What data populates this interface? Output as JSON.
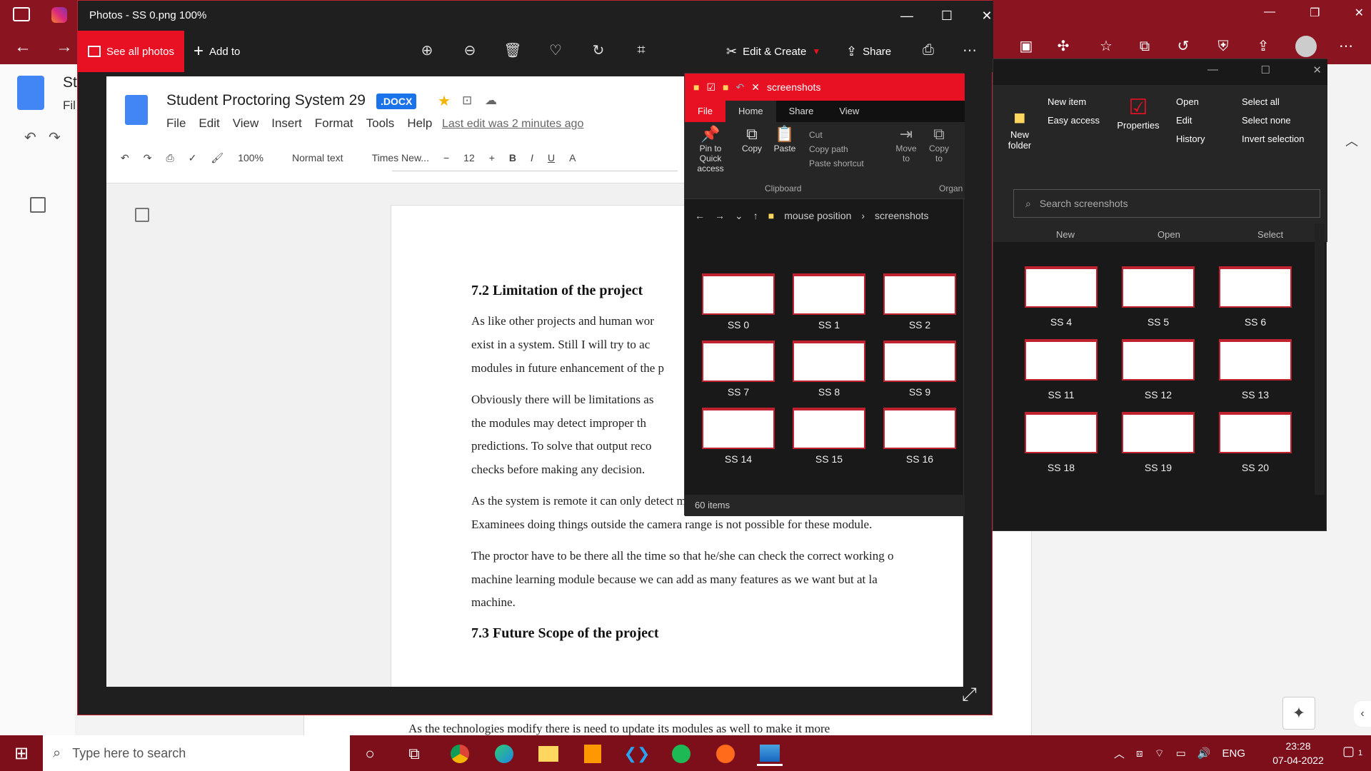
{
  "background": {
    "doc_letter": "St",
    "doc_sub": "Fil",
    "bottom_line": "As the technologies modify there is need to update its modules as well to make it more"
  },
  "photos": {
    "title": "Photos - SS 0.png   100%",
    "see_all": "See all photos",
    "add_to": "Add to",
    "edit_create": "Edit & Create",
    "share": "Share"
  },
  "doc": {
    "title": "Student Proctoring System 29",
    "badge": ".DOCX",
    "menu": [
      "File",
      "Edit",
      "View",
      "Insert",
      "Format",
      "Tools",
      "Help"
    ],
    "last_edit": "Last edit was 2 minutes ago",
    "zoom": "100%",
    "style": "Normal text",
    "font": "Times New...",
    "size": "12",
    "heading1": "7.2 Limitation of the project",
    "lines": [
      "As like other projects and human wor",
      "exist in a system. Still I will try to ac",
      "modules in future enhancement of the p",
      "Obviously there will be limitations as",
      "the modules may detect improper th",
      "predictions. To solve that output reco",
      "checks before making any decision.",
      "As the system  is remote it can only detect misconduct happening in front or inside camera r",
      "Examinees doing things outside the camera range is not possible for these module.",
      "The proctor have to be there all the time so that he/she can check the correct working o",
      "machine learning module because we can add as many features as we want but at la",
      "machine."
    ],
    "heading2": "7.3 Future Scope of the project"
  },
  "explorer1": {
    "title": "screenshots",
    "tabs": [
      "File",
      "Home",
      "Share",
      "View"
    ],
    "ribbon": {
      "pin": "Pin to Quick access",
      "copy": "Copy",
      "paste": "Paste",
      "cut": "Cut",
      "copy_path": "Copy path",
      "paste_shortcut": "Paste shortcut",
      "move_to": "Move to",
      "copy_to": "Copy to",
      "clipboard": "Clipboard",
      "organize": "Organ"
    },
    "path": [
      "mouse position",
      "screenshots"
    ],
    "thumbs": [
      "SS 0",
      "SS 1",
      "SS 2",
      "SS 7",
      "SS 8",
      "SS 9",
      "SS 14",
      "SS 15",
      "SS 16"
    ],
    "status": "60 items"
  },
  "explorer2": {
    "ribbon": {
      "new_item": "New item",
      "easy_access": "Easy access",
      "new_folder": "New folder",
      "properties": "Properties",
      "open": "Open",
      "edit": "Edit",
      "history": "History",
      "select_all": "Select all",
      "select_none": "Select none",
      "invert": "Invert selection",
      "g_new": "New",
      "g_open": "Open",
      "g_select": "Select"
    },
    "search": "Search screenshots",
    "thumbs": [
      "SS 4",
      "SS 5",
      "SS 6",
      "SS 11",
      "SS 12",
      "SS 13",
      "SS 18",
      "SS 19",
      "SS 20"
    ]
  },
  "taskbar": {
    "search": "Type here to search",
    "lang": "ENG",
    "time": "23:28",
    "date": "07-04-2022",
    "notif": "1"
  }
}
